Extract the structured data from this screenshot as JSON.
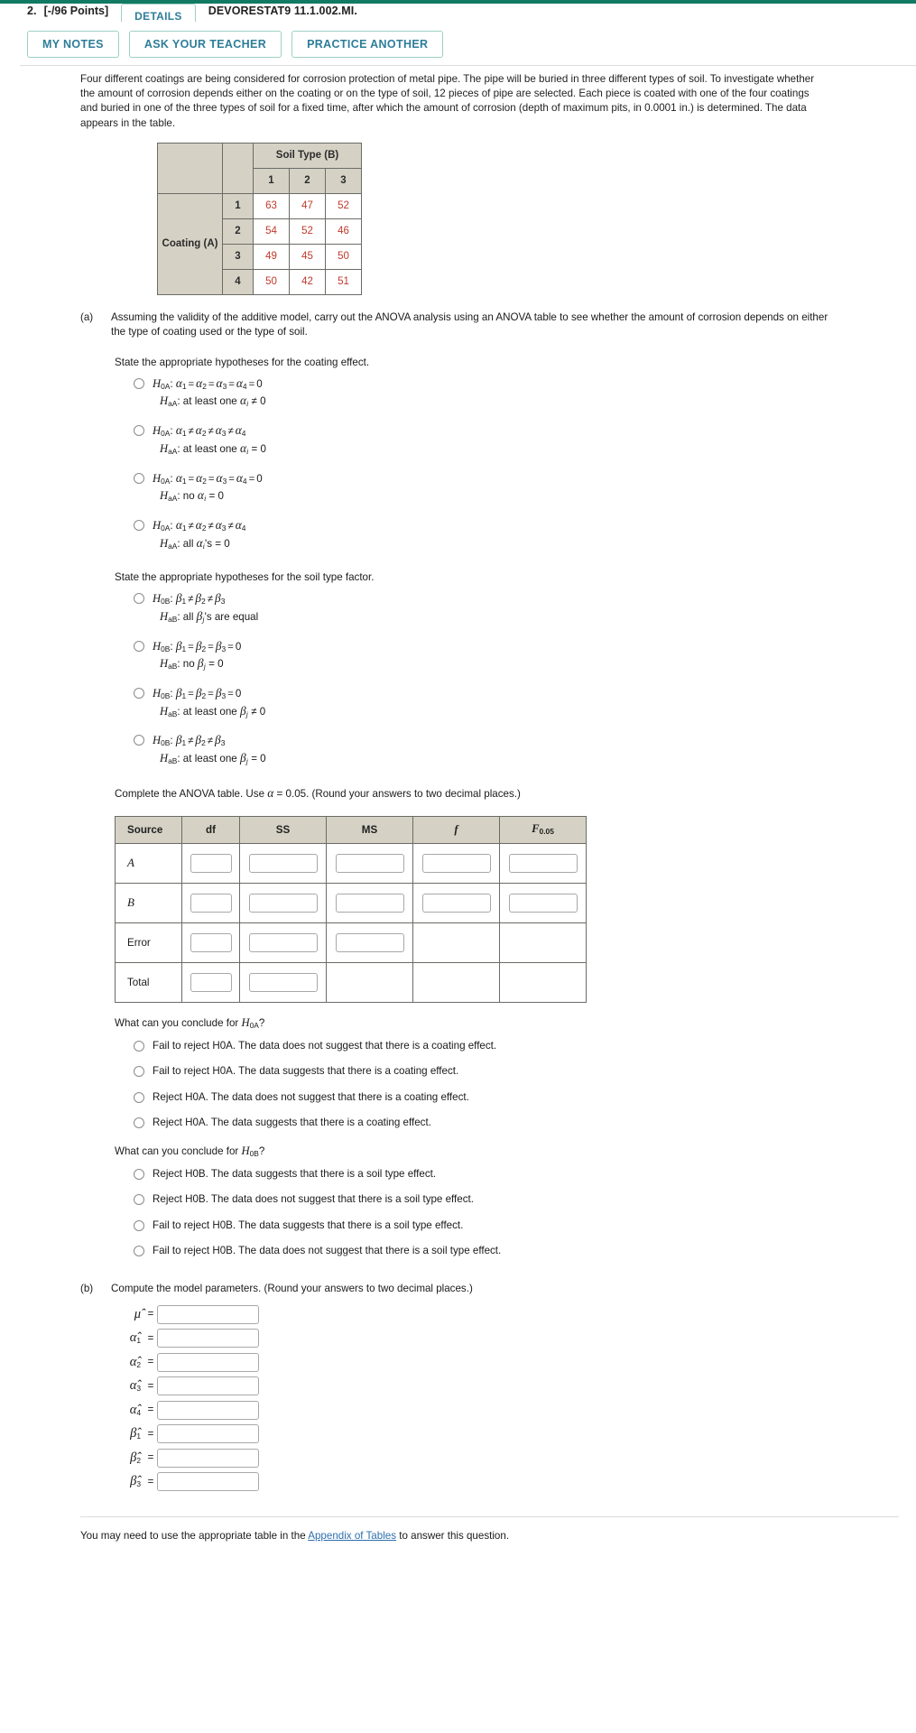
{
  "header": {
    "question_number": "2.",
    "points": "[-/96 Points]",
    "details_label": "DETAILS",
    "textbook_code": "DEVORESTAT9 11.1.002.MI."
  },
  "toolbar": {
    "my_notes": "MY NOTES",
    "ask_teacher": "ASK YOUR TEACHER",
    "practice_another": "PRACTICE ANOTHER"
  },
  "problem": {
    "statement": "Four different coatings are being considered for corrosion protection of metal pipe. The pipe will be buried in three different types of soil. To investigate whether the amount of corrosion depends either on the coating or on the type of soil, 12 pieces of pipe are selected. Each piece is coated with one of the four coatings and buried in one of the three types of soil for a fixed time, after which the amount of corrosion (depth of maximum pits, in 0.0001 in.) is determined. The data appears in the table."
  },
  "data_table": {
    "soil_header": "Soil Type (B)",
    "coating_header": "Coating (A)",
    "soil_levels": [
      "1",
      "2",
      "3"
    ],
    "coating_levels": [
      "1",
      "2",
      "3",
      "4"
    ],
    "values": [
      [
        "63",
        "47",
        "52"
      ],
      [
        "54",
        "52",
        "46"
      ],
      [
        "49",
        "45",
        "50"
      ],
      [
        "50",
        "42",
        "51"
      ]
    ]
  },
  "part_a": {
    "label": "(a)",
    "text": "Assuming the validity of the additive model, carry out the ANOVA analysis using an ANOVA table to see whether the amount of corrosion depends on either the type of coating used or the type of soil.",
    "coating_prompt": "State the appropriate hypotheses for the coating effect.",
    "soil_prompt": "State the appropriate hypotheses for the soil type factor.",
    "anova_prompt_pre": "Complete the ANOVA table. Use ",
    "anova_prompt_post": " = 0.05. (Round your answers to two decimal places.)",
    "conclude_a_pre": "What can you conclude for ",
    "conclude_a_post": "?",
    "conclude_b_pre": "What can you conclude for ",
    "conclude_b_post": "?"
  },
  "coating_options": [
    {
      "h0": "H0A: α1 = α2 = α3 = α4 = 0",
      "ha": "HaA: at least one αi ≠ 0"
    },
    {
      "h0": "H0A: α1 ≠ α2 ≠ α3 ≠ α4",
      "ha": "HaA: at least one αi = 0"
    },
    {
      "h0": "H0A: α1 = α2 = α3 = α4 = 0",
      "ha": "HaA: no αi = 0"
    },
    {
      "h0": "H0A: α1 ≠ α2 ≠ α3 ≠ α4",
      "ha": "HaA: all αi's = 0"
    }
  ],
  "soil_options": [
    {
      "h0": "H0B: β1 ≠ β2 ≠ β3",
      "ha": "HaB: all βj's are equal"
    },
    {
      "h0": "H0B: β1 = β2 = β3 = 0",
      "ha": "HaB: no βj = 0"
    },
    {
      "h0": "H0B: β1 = β2 = β3 = 0",
      "ha": "HaB: at least one βj ≠ 0"
    },
    {
      "h0": "H0B: β1 ≠ β2 ≠ β3",
      "ha": "HaB: at least one βj = 0"
    }
  ],
  "anova_table": {
    "columns": [
      "Source",
      "df",
      "SS",
      "MS",
      "f",
      "F0.05"
    ],
    "f_sub": "0.05",
    "rows": [
      {
        "source": "A",
        "italic": true,
        "df": "",
        "ss": "",
        "ms": "",
        "f": "",
        "f05": ""
      },
      {
        "source": "B",
        "italic": true,
        "df": "",
        "ss": "",
        "ms": "",
        "f": "",
        "f05": ""
      },
      {
        "source": "Error",
        "italic": false,
        "df": "",
        "ss": "",
        "ms": ""
      },
      {
        "source": "Total",
        "italic": false,
        "df": "",
        "ss": ""
      }
    ]
  },
  "conclusions_a": [
    "Fail to reject H0A. The data does not suggest that there is a coating effect.",
    "Fail to reject H0A. The data suggests that there is a coating effect.",
    "Reject H0A. The data does not suggest that there is a coating effect.",
    "Reject H0A. The data suggests that there is a coating effect."
  ],
  "conclusions_b": [
    "Reject H0B. The data suggests that there is a soil type effect.",
    "Reject H0B. The data does not suggest that there is a soil type effect.",
    "Fail to reject H0B. The data suggests that there is a soil type effect.",
    "Fail to reject H0B. The data does not suggest that there is a soil type effect."
  ],
  "part_b": {
    "label": "(b)",
    "text": "Compute the model parameters. (Round your answers to two decimal places.)",
    "parameters": [
      {
        "symbol": "μ̂",
        "sub": "",
        "value": ""
      },
      {
        "symbol": "α̂",
        "sub": "1",
        "value": ""
      },
      {
        "symbol": "α̂",
        "sub": "2",
        "value": ""
      },
      {
        "symbol": "α̂",
        "sub": "3",
        "value": ""
      },
      {
        "symbol": "α̂",
        "sub": "4",
        "value": ""
      },
      {
        "symbol": "β̂",
        "sub": "1",
        "value": ""
      },
      {
        "symbol": "β̂",
        "sub": "2",
        "value": ""
      },
      {
        "symbol": "β̂",
        "sub": "3",
        "value": ""
      }
    ]
  },
  "footer": {
    "text_pre": "You may need to use the appropriate table in the ",
    "link": "Appendix of Tables",
    "text_post": " to answer this question."
  },
  "colors": {
    "accent_green": "#127a63",
    "button_text": "#2d7d9a",
    "button_border": "#9ecfc4",
    "table_shade": "#d5d2c5",
    "data_value": "#c0392b",
    "link": "#2e6fae"
  }
}
